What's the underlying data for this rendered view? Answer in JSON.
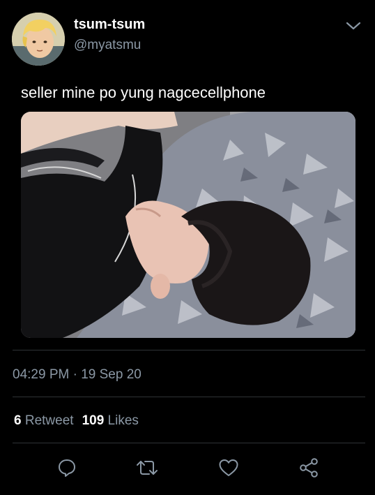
{
  "user": {
    "display_name": "tsum-tsum",
    "handle": "@myatsmu"
  },
  "tweet": {
    "text": "seller mine po yung nagcecellphone",
    "time": "04:29 PM",
    "separator": "·",
    "date": "19 Sep 20"
  },
  "stats": {
    "retweet_count": "6",
    "retweet_label": "Retweet",
    "likes_count": "109",
    "likes_label": "Likes"
  },
  "icons": {
    "more": "chevron-down-icon",
    "reply": "reply-icon",
    "retweet": "retweet-icon",
    "like": "heart-icon",
    "share": "share-icon"
  },
  "colors": {
    "background": "#000000",
    "primary_text": "#ffffff",
    "secondary_text": "#8b98a5",
    "divider": "#2f3336",
    "icon": "#8b98a5"
  }
}
